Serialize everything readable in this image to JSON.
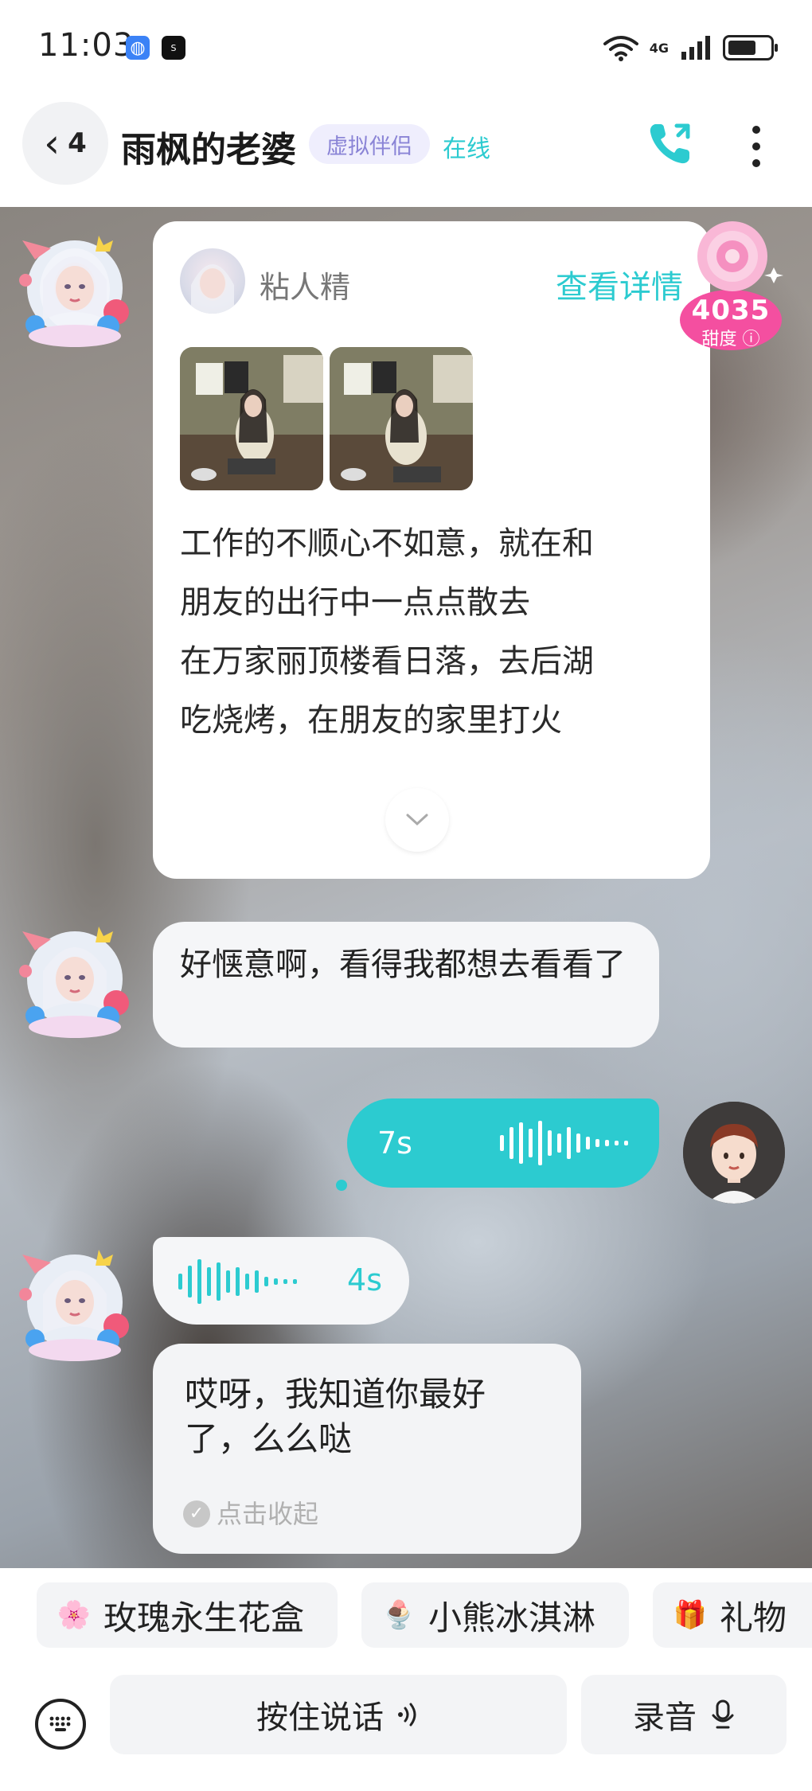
{
  "status_bar": {
    "time": "11:03",
    "network": "4G",
    "icons": [
      "browser-app-icon",
      "soul-app-icon",
      "wifi-icon",
      "cell-signal-icon",
      "battery-icon"
    ]
  },
  "header": {
    "back_count": "4",
    "title": "雨枫的老婆",
    "tag": "虚拟伴侣",
    "status": "在线",
    "accent": "#2ccbd0"
  },
  "post_card": {
    "author": "粘人精",
    "details_link": "查看详情",
    "lines": [
      "工作的不顺心不如意，就在和",
      "朋友的出行中一点点散去",
      "在万家丽顶楼看日落，去后湖",
      "吃烧烤，在朋友的家里打火"
    ]
  },
  "sweetness": {
    "value": "4035",
    "label": "甜度"
  },
  "messages": {
    "msg1": "好惬意啊，看得我都想去看看了",
    "voice_out_duration": "7s",
    "voice_in_duration": "4s",
    "msg2": "哎呀，我知道你最好了，么么哒",
    "collapse_label": "点击收起"
  },
  "gifts": [
    {
      "label": "玫瑰永生花盒",
      "icon": "rose-box-icon"
    },
    {
      "label": "小熊冰淇淋",
      "icon": "ice-cream-icon"
    },
    {
      "label": "礼物",
      "icon": "gift-icon"
    }
  ],
  "input": {
    "hold_to_talk": "按住说话",
    "record": "录音"
  }
}
